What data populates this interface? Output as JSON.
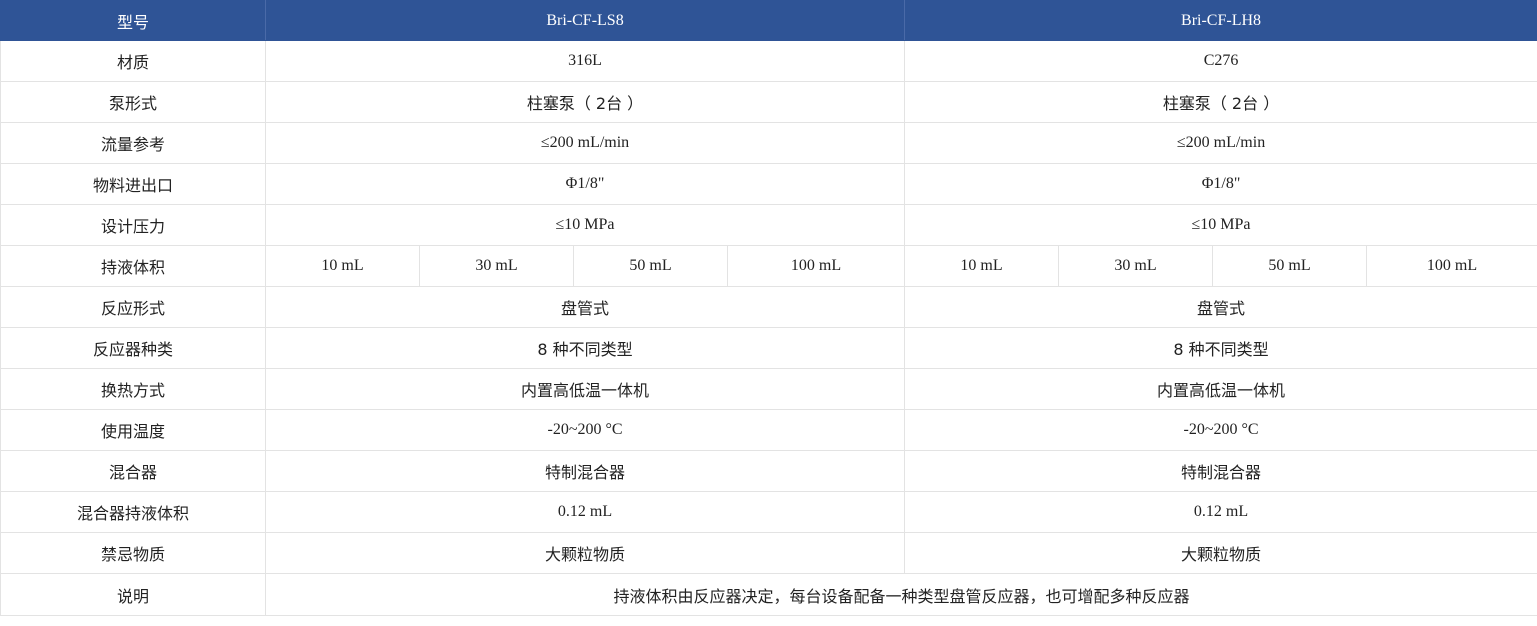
{
  "header": {
    "label": "型号",
    "model_a": "Bri-CF-LS8",
    "model_b": "Bri-CF-LH8"
  },
  "rows": {
    "material": {
      "label": "材质",
      "a": "316L",
      "b": "C276"
    },
    "pump": {
      "label": "泵形式",
      "a": "柱塞泵（ 2台 ）",
      "b": "柱塞泵（ 2台 ）"
    },
    "flow": {
      "label": "流量参考",
      "a": "≤200 mL/min",
      "b": "≤200 mL/min"
    },
    "port": {
      "label": "物料进出口",
      "a": "Φ1/8\"",
      "b": "Φ1/8\""
    },
    "pressure": {
      "label": "设计压力",
      "a": "≤10 MPa",
      "b": "≤10 MPa"
    },
    "holdup": {
      "label": "持液体积",
      "a": [
        "10 mL",
        "30 mL",
        "50 mL",
        "100 mL"
      ],
      "b": [
        "10 mL",
        "30 mL",
        "50 mL",
        "100 mL"
      ]
    },
    "reactor_form": {
      "label": "反应形式",
      "a": "盘管式",
      "b": "盘管式"
    },
    "reactor_types": {
      "label": "反应器种类",
      "a": "8 种不同类型",
      "b": "8 种不同类型"
    },
    "heat_exchange": {
      "label": "换热方式",
      "a": "内置高低温一体机",
      "b": "内置高低温一体机"
    },
    "temperature": {
      "label": "使用温度",
      "a": "-20~200 °C",
      "b": "-20~200 °C"
    },
    "mixer": {
      "label": "混合器",
      "a": "特制混合器",
      "b": "特制混合器"
    },
    "mixer_holdup": {
      "label": "混合器持液体积",
      "a": "0.12 mL",
      "b": "0.12 mL"
    },
    "forbidden": {
      "label": "禁忌物质",
      "a": "大颗粒物质",
      "b": "大颗粒物质"
    },
    "note": {
      "label": "说明",
      "value": "持液体积由反应器决定，每台设备配备一种类型盘管反应器，也可增配多种反应器"
    }
  },
  "colors": {
    "header_bg": "#2f5496",
    "header_text": "#ffffff",
    "border": "#e3e3e3"
  }
}
